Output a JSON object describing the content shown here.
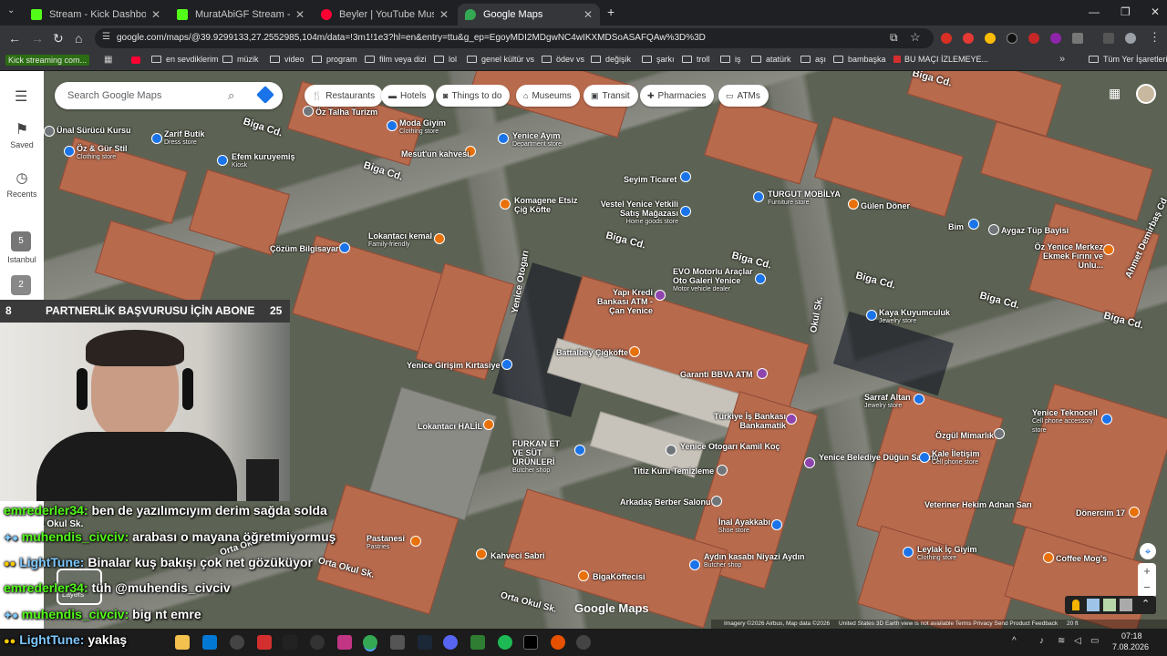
{
  "tabs": [
    {
      "title": "Stream - Kick Dashboard",
      "color": "#53fc18"
    },
    {
      "title": "MuratAbiGF Stream - Watch Live",
      "color": "#53fc18"
    },
    {
      "title": "Beyler | YouTube Music",
      "color": "#ff0033"
    },
    {
      "title": "Google Maps",
      "color": "#34a853"
    }
  ],
  "url": "google.com/maps/@39.9299133,27.2552985,104m/data=!3m1!1e3?hl=en&entry=ttu&g_ep=EgoyMDI2MDgwNC4wIKXMDSoASAFQAw%3D%3D",
  "bookmarks": [
    "Kick streaming com...",
    "en sevdiklerim",
    "müzik",
    "video",
    "program",
    "film veya dizi",
    "lol",
    "genel kültür vs",
    "ödev vs",
    "değişik",
    "şarkı",
    "troll",
    "iş",
    "atatürk",
    "aşı",
    "bambaşka",
    "BU MAÇI İZLEMEYE...",
    "Tüm Yer İşaretleri"
  ],
  "search": {
    "placeholder": "Search Google Maps"
  },
  "chips": [
    "Restaurants",
    "Hotels",
    "Things to do",
    "Museums",
    "Transit",
    "Pharmacies",
    "ATMs"
  ],
  "sidebar": {
    "saved": "Saved",
    "recents": "Recents",
    "recent1": "Istanbul"
  },
  "places": [
    {
      "name": "Ünal Sürücü Kursu",
      "sub": ""
    },
    {
      "name": "Zarif Butik",
      "sub": "Dress store"
    },
    {
      "name": "Öz & Gür Stil",
      "sub": "Clothing store"
    },
    {
      "name": "Efem kuruyemiş",
      "sub": "Kiosk"
    },
    {
      "name": "Öz Talha Turizm",
      "sub": ""
    },
    {
      "name": "Moda Giyim",
      "sub": "Clothing store"
    },
    {
      "name": "Mesut'un kahvesi",
      "sub": ""
    },
    {
      "name": "Yenice Ayım",
      "sub": "Department store"
    },
    {
      "name": "Seyim Ticaret",
      "sub": ""
    },
    {
      "name": "TURGUT MOBİLYA",
      "sub": "Furniture store"
    },
    {
      "name": "Gülen Döner",
      "sub": ""
    },
    {
      "name": "Komagene Etsiz Çiğ Köfte",
      "sub": ""
    },
    {
      "name": "Vestel Yenice Yetkili Satış Mağazası",
      "sub": "Home goods store"
    },
    {
      "name": "Bim",
      "sub": ""
    },
    {
      "name": "Aygaz Tüp Bayisi",
      "sub": ""
    },
    {
      "name": "Öz Yenice Merkez Ekmek Fırını ve Unlu...",
      "sub": ""
    },
    {
      "name": "Çözüm Bilgisayar",
      "sub": ""
    },
    {
      "name": "Lokantacı kemal",
      "sub": "Family-friendly"
    },
    {
      "name": "EVO Motorlu Araçlar Oto Galeri Yenice",
      "sub": "Motor vehicle dealer"
    },
    {
      "name": "Yapı Kredi Bankası ATM - Çan Yenice",
      "sub": ""
    },
    {
      "name": "Kaya Kuyumculuk",
      "sub": "Jewelry store"
    },
    {
      "name": "Battalbey Çiğköfte",
      "sub": ""
    },
    {
      "name": "Garanti BBVA ATM",
      "sub": ""
    },
    {
      "name": "Yenice Girişim Kırtasiye",
      "sub": ""
    },
    {
      "name": "Sarraf Altan",
      "sub": "Jewelry store"
    },
    {
      "name": "Yenice Teknocell",
      "sub": "Cell phone accessory store"
    },
    {
      "name": "Türkiye İş Bankası Bankamatik",
      "sub": ""
    },
    {
      "name": "Lokantacı HALİL",
      "sub": ""
    },
    {
      "name": "Özgül Mimarlık",
      "sub": ""
    },
    {
      "name": "FURKAN ET VE SÜT ÜRÜNLERİ",
      "sub": "Butcher shop"
    },
    {
      "name": "Yenice Otogarı Kamil Koç",
      "sub": ""
    },
    {
      "name": "Yenice Belediye Düğün Salonu",
      "sub": ""
    },
    {
      "name": "Kale İletişim",
      "sub": "Cell phone store"
    },
    {
      "name": "Titiz Kuru Temizleme",
      "sub": ""
    },
    {
      "name": "Arkadaş Berber Salonu",
      "sub": ""
    },
    {
      "name": "Veteriner Hekim Adnan Sarı",
      "sub": ""
    },
    {
      "name": "Dönercim 17",
      "sub": ""
    },
    {
      "name": "İnal Ayakkabı",
      "sub": "Shoe store"
    },
    {
      "name": "Leylak İç Giyim",
      "sub": "Clothing store"
    },
    {
      "name": "Coffee Mog's",
      "sub": ""
    },
    {
      "name": "Kahveci Sabri",
      "sub": ""
    },
    {
      "name": "Aydın kasabı Niyazi Aydın",
      "sub": "Butcher shop"
    },
    {
      "name": "BigaKöftecisi",
      "sub": ""
    },
    {
      "name": "Pastanesi",
      "sub": "Pastries"
    }
  ],
  "streets": [
    "Biga Cd.",
    "Biga Cd.",
    "Biga Cd.",
    "Biga Cd.",
    "Biga Cd.",
    "Biga Cd.",
    "Biga Cd.",
    "Biga Cd.",
    "Yenice Otogarı",
    "Okul Sk.",
    "Orta Okul Sk.",
    "Orta Okul Sk.",
    "Orta Okul Sk.",
    "Ahmet Demirbaş Cd",
    "Orta Okul Sk."
  ],
  "map_footer": {
    "logo": "Google Maps",
    "layers": "Layers",
    "attribution": "Imagery ©2026 Airbus, Map data ©2026",
    "terms": "United States  3D Earth view is not available  Terms  Privacy  Send Product Feedback",
    "scale": "20 ft"
  },
  "overlay": {
    "banner_left": "8",
    "banner_text": "PARTNERLİK BAŞVURUSU İÇİN ABONE",
    "banner_right": "25"
  },
  "chat": [
    {
      "user": "emrederler34:",
      "msg": "ben de yazılımcıyım derim sağda solda"
    },
    {
      "user": "muhendis_civciv:",
      "msg": "arabası o mayana öğretmiyormuş"
    },
    {
      "user": "LightTune:",
      "msg": "Binalar kuş bakışı çok net gözüküyor"
    },
    {
      "user": "emrederler34:",
      "msg": "tüh @muhendis_civciv"
    },
    {
      "user": "muhendis_civciv:",
      "msg": "big nt emre"
    },
    {
      "user": "LightTune:",
      "msg": "yaklaş"
    }
  ],
  "clock": {
    "time": "07:18",
    "date": "7.08.2026"
  }
}
